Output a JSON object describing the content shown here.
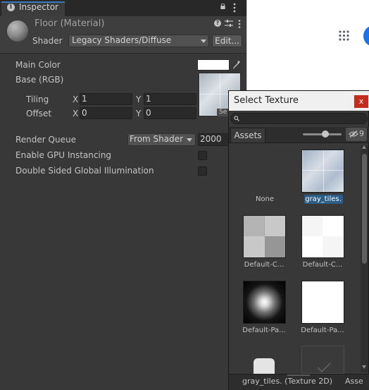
{
  "inspector": {
    "tab_label": "Inspector",
    "tab_icon": "info-icon",
    "material_name": "Floor (Material)",
    "shader_label": "Shader",
    "shader_value": "Legacy Shaders/Diffuse",
    "edit_label": "Edit...",
    "main_color_label": "Main Color",
    "main_color": "#ffffff",
    "base_rgb_label": "Base (RGB)",
    "select_button_label": "Se",
    "tiling_label": "Tiling",
    "offset_label": "Offset",
    "x_label": "X",
    "y_label": "Y",
    "tiling_x": "1",
    "tiling_y": "1",
    "offset_x": "0",
    "offset_y": "0",
    "render_queue_label": "Render Queue",
    "render_queue_mode": "From Shader",
    "render_queue_value": "2000",
    "gpu_instancing_label": "Enable GPU Instancing",
    "gpu_instancing_checked": false,
    "dsgi_label": "Double Sided Global Illumination",
    "dsgi_checked": false
  },
  "select_texture": {
    "title": "Select Texture",
    "close_label": "x",
    "search_placeholder": "",
    "tab_assets": "Assets",
    "hidden_count": "9",
    "items": [
      {
        "label": "None",
        "selected": false
      },
      {
        "label": "gray_tiles.",
        "selected": true
      },
      {
        "label": "Default-C...",
        "selected": false
      },
      {
        "label": "Default-C...",
        "selected": false
      },
      {
        "label": "Default-Pa...",
        "selected": false
      },
      {
        "label": "Default-Pa...",
        "selected": false
      }
    ],
    "status_text": "gray_tiles. (Texture 2D)",
    "status_right": "Asse"
  },
  "colors": {
    "accent": "#3a79bb",
    "selection": "#2c5d87",
    "close_red": "#c42b1c"
  }
}
